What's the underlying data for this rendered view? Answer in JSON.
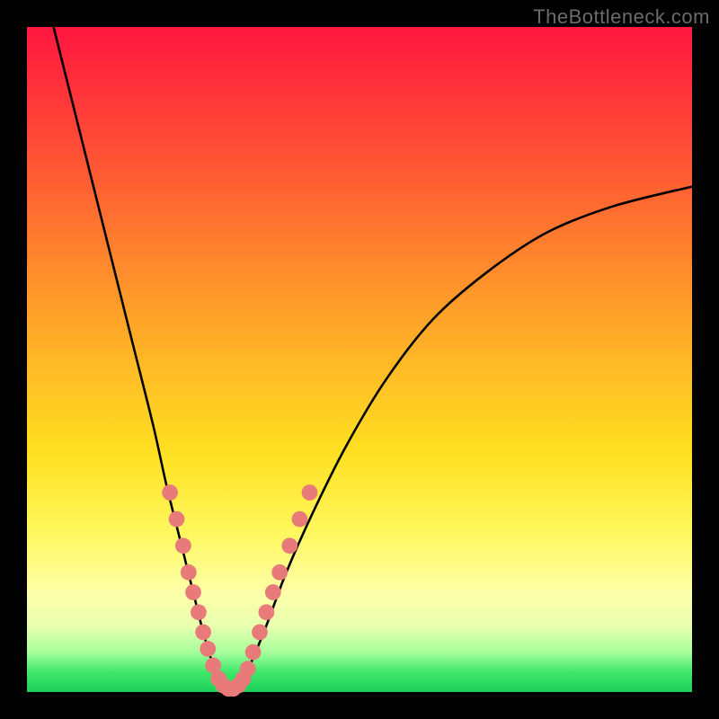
{
  "watermark": "TheBottleneck.com",
  "gradient": {
    "top": "#ff173f",
    "mid1": "#ff8a2c",
    "mid2": "#ffe021",
    "pale": "#feffa8",
    "green": "#1ccf59"
  },
  "chart_data": {
    "type": "line",
    "title": "",
    "xlabel": "",
    "ylabel": "",
    "xlim": [
      0,
      100
    ],
    "ylim": [
      0,
      100
    ],
    "series": [
      {
        "name": "bottleneck-curve",
        "x": [
          4,
          7,
          10,
          13,
          16,
          19,
          21,
          23,
          25,
          26.5,
          28,
          29,
          30,
          31,
          32,
          33.5,
          36,
          39,
          43,
          48,
          54,
          61,
          69,
          78,
          88,
          100
        ],
        "y": [
          100,
          88,
          76,
          64,
          52,
          40,
          31,
          23,
          15,
          9,
          4,
          1.5,
          0.5,
          0.5,
          1.5,
          4,
          10,
          18,
          27,
          37,
          47,
          56,
          63,
          69,
          73,
          76
        ]
      }
    ],
    "markers": {
      "name": "highlight-dots",
      "color": "#e97a7a",
      "radius": 1.2,
      "points": [
        {
          "x": 21.5,
          "y": 30
        },
        {
          "x": 22.5,
          "y": 26
        },
        {
          "x": 23.5,
          "y": 22
        },
        {
          "x": 24.3,
          "y": 18
        },
        {
          "x": 25.0,
          "y": 15
        },
        {
          "x": 25.8,
          "y": 12
        },
        {
          "x": 26.5,
          "y": 9
        },
        {
          "x": 27.2,
          "y": 6.5
        },
        {
          "x": 28.0,
          "y": 4
        },
        {
          "x": 28.8,
          "y": 2
        },
        {
          "x": 29.5,
          "y": 1
        },
        {
          "x": 30.3,
          "y": 0.5
        },
        {
          "x": 31.0,
          "y": 0.5
        },
        {
          "x": 31.8,
          "y": 1
        },
        {
          "x": 32.5,
          "y": 2
        },
        {
          "x": 33.2,
          "y": 3.5
        },
        {
          "x": 34.0,
          "y": 6
        },
        {
          "x": 35.0,
          "y": 9
        },
        {
          "x": 36.0,
          "y": 12
        },
        {
          "x": 37.0,
          "y": 15
        },
        {
          "x": 38.0,
          "y": 18
        },
        {
          "x": 39.5,
          "y": 22
        },
        {
          "x": 41.0,
          "y": 26
        },
        {
          "x": 42.5,
          "y": 30
        }
      ]
    }
  }
}
